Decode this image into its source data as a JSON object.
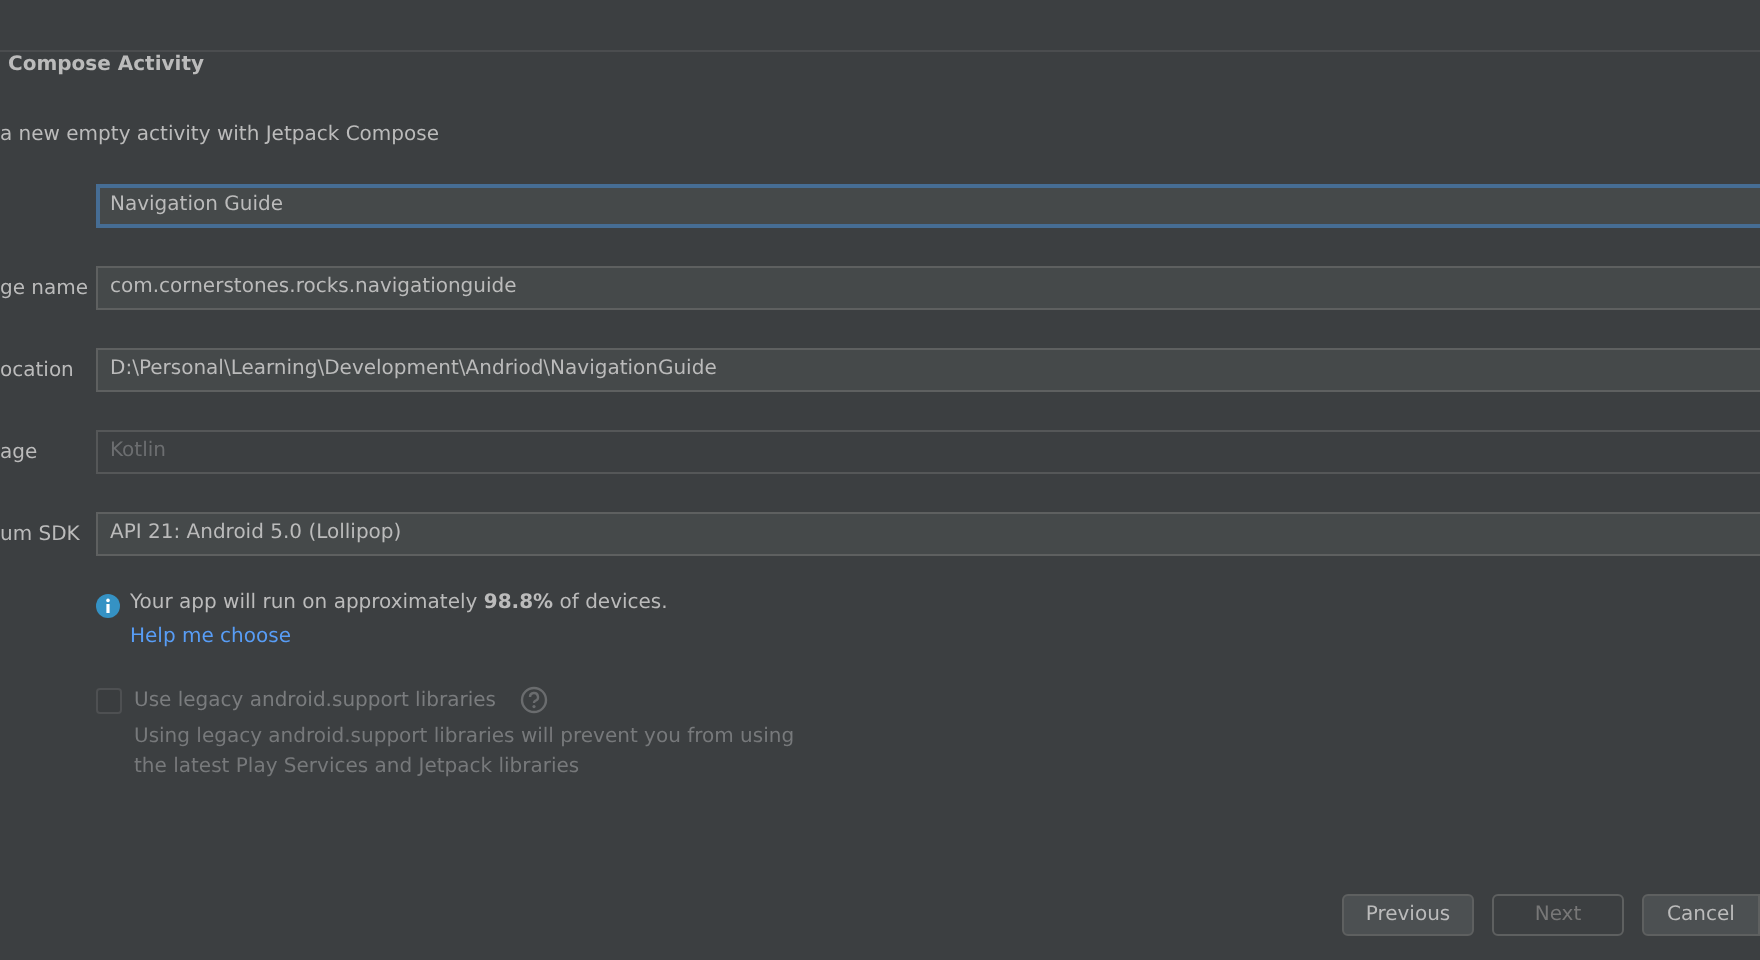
{
  "header": {
    "title": "Compose Activity",
    "subtitle": "a new empty activity with Jetpack Compose"
  },
  "fields": [
    {
      "value": "Navigation Guide",
      "focused": true,
      "disabled": false
    },
    {
      "label": "ge name",
      "value": "com.cornerstones.rocks.navigationguide",
      "focused": false,
      "disabled": false
    },
    {
      "label": "ocation",
      "value": "D:\\Personal\\Learning\\Development\\Andriod\\NavigationGuide",
      "focused": false,
      "disabled": false
    },
    {
      "label": "age",
      "value": "Kotlin",
      "focused": false,
      "disabled": true
    },
    {
      "label": "um SDK",
      "value": "API 21: Android 5.0 (Lollipop)",
      "focused": false,
      "disabled": false
    }
  ],
  "info": {
    "text": "Your app will run on approximately **98.8%** of devices.",
    "link": "Help me choose"
  },
  "legacy": {
    "label": "Use legacy android.support libraries",
    "checked": false,
    "disabled": true,
    "description": "Using legacy android.support libraries will prevent you from using the latest Play Services and Jetpack libraries"
  },
  "buttons": [
    {
      "label": "Previous",
      "disabled": false
    },
    {
      "label": "Next",
      "disabled": true
    },
    {
      "label": "Cancel",
      "disabled": false
    }
  ]
}
